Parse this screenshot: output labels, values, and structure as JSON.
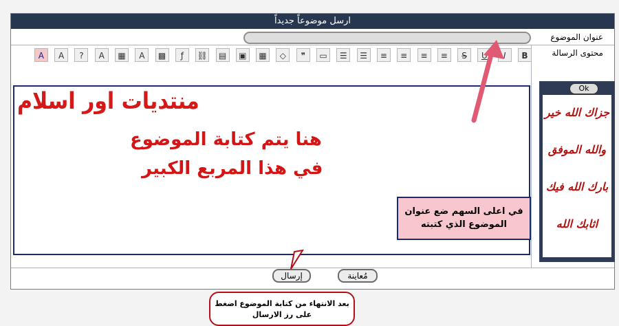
{
  "header": {
    "title": "ارسل موضوعاً جديداً"
  },
  "labels": {
    "subject": "عنوان الموضوع",
    "message": "محتوى الرسالة"
  },
  "subject_input": {
    "value": ""
  },
  "toolbar": {
    "buttons": [
      {
        "name": "bold-button",
        "glyph": "B"
      },
      {
        "name": "italic-button",
        "glyph": "I"
      },
      {
        "name": "underline-button",
        "glyph": "U"
      },
      {
        "name": "strike-button",
        "glyph": "S"
      },
      {
        "name": "align-left-button",
        "glyph": "≡"
      },
      {
        "name": "align-center-button",
        "glyph": "≡"
      },
      {
        "name": "align-right-button",
        "glyph": "≡"
      },
      {
        "name": "justify-button",
        "glyph": "≡"
      },
      {
        "name": "ordered-list-button",
        "glyph": "☰"
      },
      {
        "name": "bullet-list-button",
        "glyph": "☰"
      },
      {
        "name": "hr-button",
        "glyph": "▭"
      },
      {
        "name": "quote-button",
        "glyph": "❞"
      },
      {
        "name": "code-button",
        "glyph": "◇"
      },
      {
        "name": "table-button",
        "glyph": "▦"
      },
      {
        "name": "image-button",
        "glyph": "▣"
      },
      {
        "name": "picture-button",
        "glyph": "▤"
      },
      {
        "name": "link-button",
        "glyph": "⛓"
      },
      {
        "name": "flash-button",
        "glyph": "ƒ"
      },
      {
        "name": "video-button",
        "glyph": "▩"
      },
      {
        "name": "font-button",
        "glyph": "A"
      },
      {
        "name": "color-button",
        "glyph": "▦"
      },
      {
        "name": "font-style-button",
        "glyph": "A"
      },
      {
        "name": "help-button",
        "glyph": "?"
      },
      {
        "name": "font-color-button",
        "glyph": "A"
      },
      {
        "name": "font-size-button",
        "glyph": "A"
      }
    ]
  },
  "editor": {
    "logo": "منتديات اور اسلام",
    "line1": "هنا يتم كتابة الموضوع",
    "line2": "في هذا المربع الكبير"
  },
  "tip": {
    "text": "في اعلى السهم ضع عنوان الموضوع الذي كتبته"
  },
  "bubble": {
    "text": "بعد الانتهاء من كتابة الموضوع اضغط على رز الارسال"
  },
  "side_panel": {
    "ok_label": "Ok",
    "phrases": [
      "جزاك الله خير",
      "والله الموفق",
      "بارك الله فيك",
      "اثابك الله"
    ]
  },
  "buttons": {
    "preview": "مُعاينة",
    "send": "إرسال"
  },
  "colors": {
    "header_bg": "#26374f",
    "accent_red": "#d31515",
    "tip_bg": "#f7c7cd",
    "arrow": "#e05a74"
  }
}
